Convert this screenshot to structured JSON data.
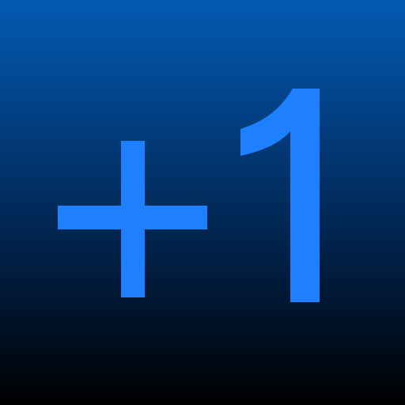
{
  "icon": {
    "label": "+1",
    "glyph_color": "#1e80ff",
    "background_top": "#035ab3",
    "background_bottom": "#000000"
  }
}
